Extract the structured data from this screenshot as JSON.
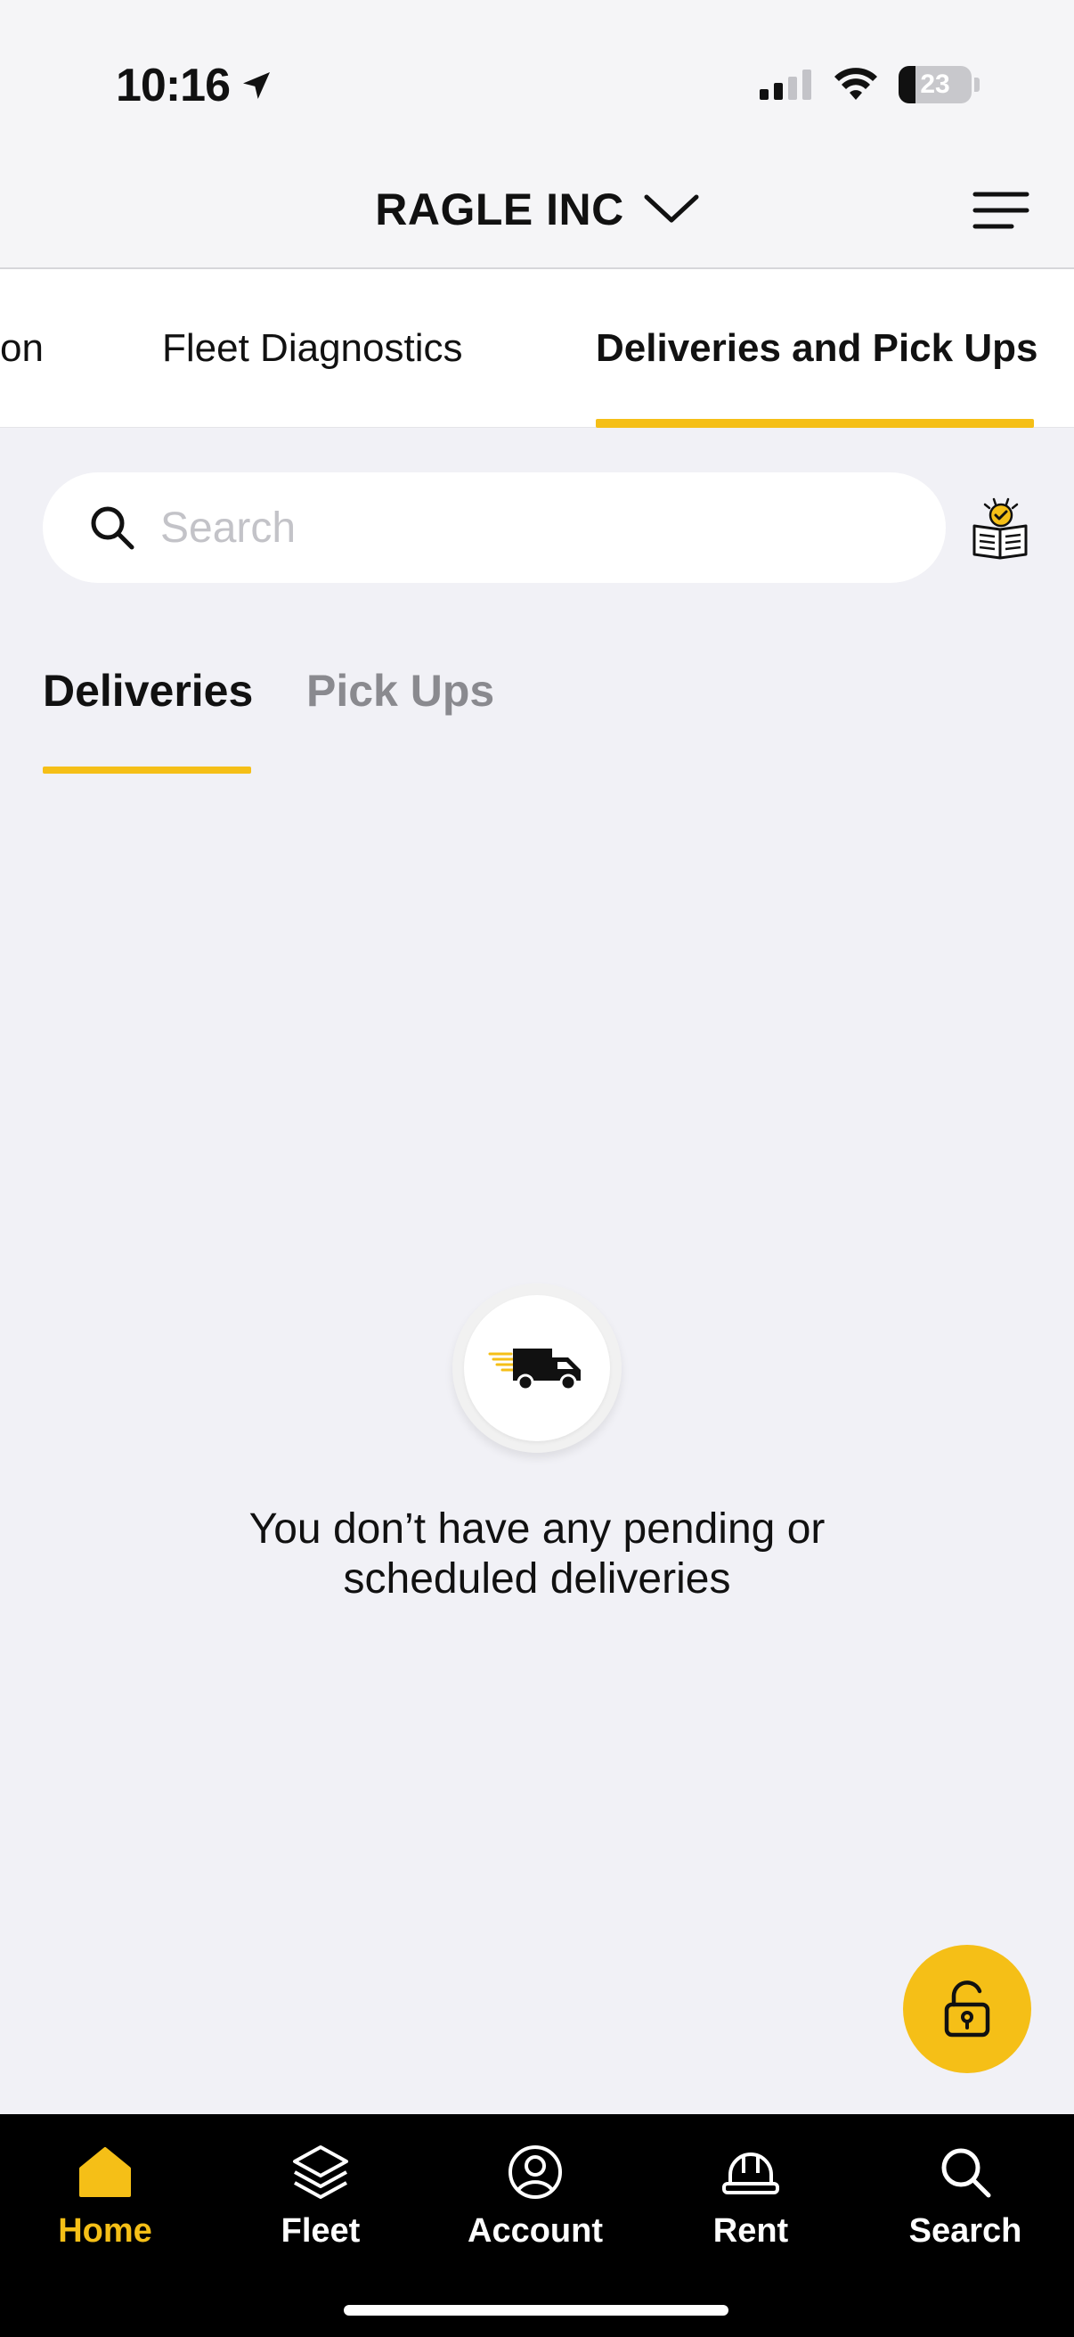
{
  "status_bar": {
    "time": "10:16",
    "battery_level": "23",
    "battery_fraction": 0.23
  },
  "header": {
    "company_name": "RAGLE INC"
  },
  "top_tabs": [
    {
      "label": "on"
    },
    {
      "label": "Fleet Diagnostics"
    },
    {
      "label": "Deliveries and Pick Ups",
      "active": true
    }
  ],
  "search": {
    "placeholder": "Search",
    "value": ""
  },
  "sub_tabs": [
    {
      "label": "Deliveries",
      "active": true
    },
    {
      "label": "Pick Ups",
      "active": false
    }
  ],
  "empty_state": {
    "icon": "delivery-truck-icon",
    "line1": "You don’t have any pending or",
    "line2": "scheduled deliveries"
  },
  "bottom_nav": [
    {
      "label": "Home",
      "icon": "home-icon",
      "active": true
    },
    {
      "label": "Fleet",
      "icon": "layers-icon"
    },
    {
      "label": "Account",
      "icon": "account-icon"
    },
    {
      "label": "Rent",
      "icon": "hard-hat-icon"
    },
    {
      "label": "Search",
      "icon": "search-icon"
    }
  ],
  "colors": {
    "accent": "#f5bf17",
    "background": "#f1f1f6",
    "nav_background": "#000000"
  }
}
